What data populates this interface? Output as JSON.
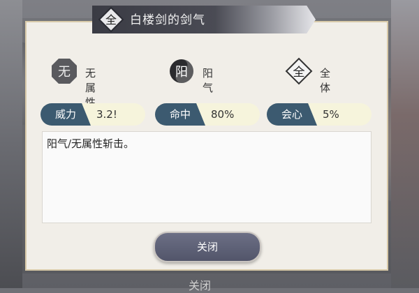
{
  "dialog": {
    "title_badge": "全",
    "title": "白楼剑的剑气",
    "attributes": [
      {
        "glyph": "无",
        "label": "无属性"
      },
      {
        "glyph": "阳",
        "label": "阳气"
      },
      {
        "glyph": "全",
        "label": "全体"
      }
    ],
    "stats": [
      {
        "label": "威力",
        "value": "3.2!"
      },
      {
        "label": "命中",
        "value": "80%"
      },
      {
        "label": "会心",
        "value": "5%"
      }
    ],
    "description": "阳气/无属性斩击。",
    "close_label": "关闭"
  },
  "background": {
    "bottom_text": "关闭"
  },
  "colors": {
    "stat_label_bg": "#3c5a70",
    "close_button_bg": "#5d6077"
  }
}
